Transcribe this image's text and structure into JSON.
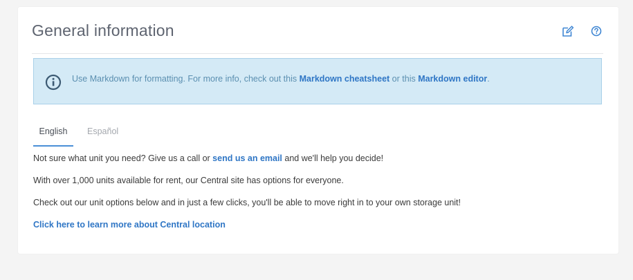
{
  "card": {
    "title": "General information",
    "edit_icon": "edit-icon",
    "help_icon": "help-icon"
  },
  "info": {
    "icon": "info-icon",
    "text_before": "Use Markdown for formatting. For more info, check out this ",
    "link1": "Markdown cheatsheet",
    "text_middle": " or this ",
    "link2": "Markdown editor",
    "text_after": "."
  },
  "tabs": [
    {
      "label": "English",
      "active": true
    },
    {
      "label": "Español",
      "active": false
    }
  ],
  "content": {
    "line1_before": "Not sure what unit you need? Give us a call or ",
    "line1_link": "send us an email",
    "line1_after": " and we'll help you decide!",
    "line2": "With over 1,000 units available for rent, our Central site has options for everyone.",
    "line3": "Check out our unit options below and in just a few clicks, you'll be able to move right in to your own storage unit!",
    "line4_link": "Click here to learn more about Central location"
  },
  "colors": {
    "accent": "#2f76c5",
    "info_bg": "#d4eaf6",
    "info_border": "#a9d0e9",
    "page_bg": "#f4f4f4"
  }
}
